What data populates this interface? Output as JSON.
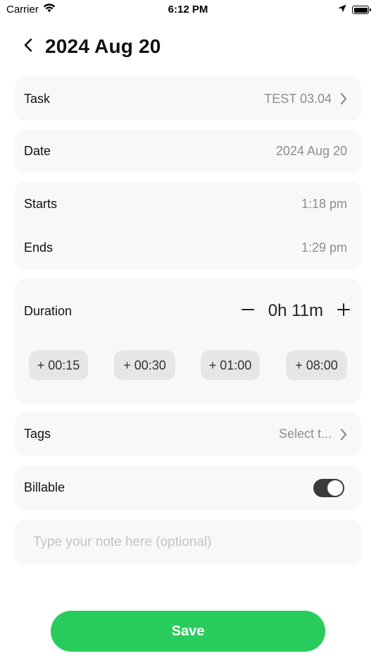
{
  "status_bar": {
    "carrier": "Carrier",
    "time": "6:12 PM",
    "icons": [
      "wifi-icon",
      "location-arrow-icon",
      "battery-icon"
    ]
  },
  "header": {
    "title": "2024 Aug 20",
    "back_icon": "chevron-left-icon"
  },
  "task": {
    "label": "Task",
    "value": "TEST 03.04"
  },
  "date": {
    "label": "Date",
    "value": "2024 Aug 20"
  },
  "time_range": {
    "starts_label": "Starts",
    "starts_value": "1:18 pm",
    "ends_label": "Ends",
    "ends_value": "1:29 pm"
  },
  "duration": {
    "label": "Duration",
    "value": "0h 11m",
    "quick_adds": [
      "+ 00:15",
      "+ 00:30",
      "+ 01:00",
      "+ 08:00"
    ]
  },
  "tags": {
    "label": "Tags",
    "value": "Select t..."
  },
  "billable": {
    "label": "Billable",
    "enabled": true
  },
  "note": {
    "placeholder": "Type your note here (optional)",
    "value": ""
  },
  "save": {
    "label": "Save"
  },
  "colors": {
    "accent": "#28cc5c",
    "card_bg": "#f8f8f8",
    "chip_bg": "#e6e6e6",
    "toggle_on": "#3a3a3a",
    "muted_text": "#8e8e8e"
  }
}
